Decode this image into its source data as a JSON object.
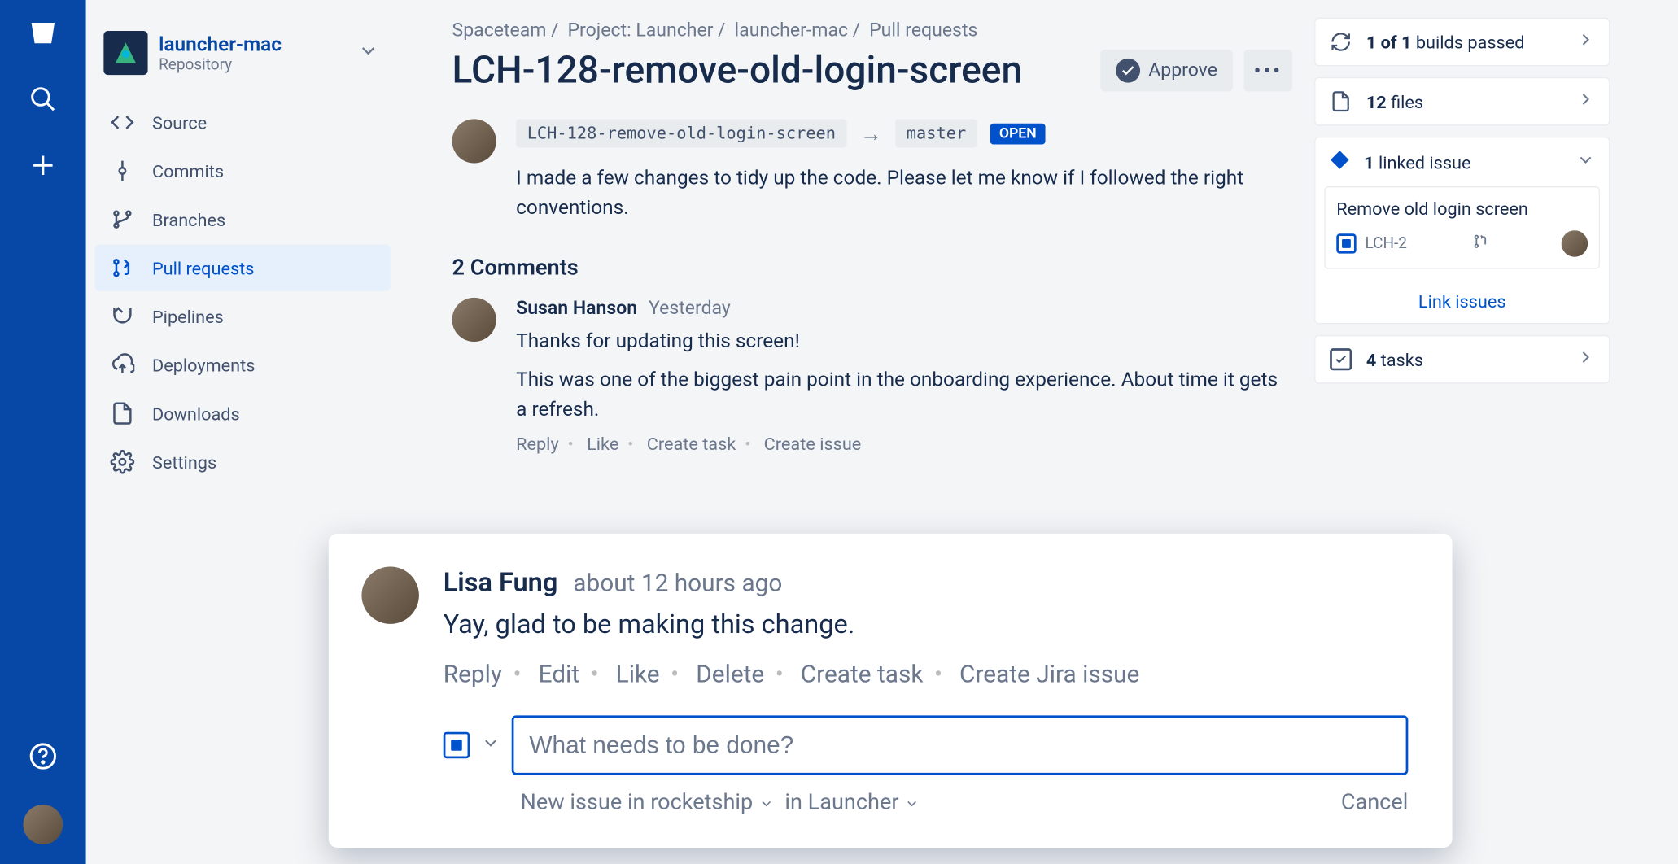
{
  "sidebar": {
    "repo_name": "launcher-mac",
    "repo_sub": "Repository",
    "items": [
      {
        "label": "Source"
      },
      {
        "label": "Commits"
      },
      {
        "label": "Branches"
      },
      {
        "label": "Pull requests"
      },
      {
        "label": "Pipelines"
      },
      {
        "label": "Deployments"
      },
      {
        "label": "Downloads"
      },
      {
        "label": "Settings"
      }
    ]
  },
  "breadcrumbs": [
    "Spaceteam",
    "Project: Launcher",
    "launcher-mac",
    "Pull requests"
  ],
  "pr": {
    "title": "LCH-128-remove-old-login-screen",
    "approve_label": "Approve",
    "source_branch": "LCH-128-remove-old-login-screen",
    "target_branch": "master",
    "status": "OPEN",
    "description": "I made a few changes to tidy up the code. Please let me know if I followed the right conventions."
  },
  "comments": {
    "heading": "2 Comments",
    "list": [
      {
        "author": "Susan Hanson",
        "time": "Yesterday",
        "body1": "Thanks for updating this screen!",
        "body2": "This was one of the biggest pain point in the onboarding experience. About time it gets a refresh.",
        "actions": {
          "reply": "Reply",
          "like": "Like",
          "task": "Create task",
          "issue": "Create issue"
        }
      }
    ]
  },
  "popover": {
    "author": "Lisa Fung",
    "time": "about 12 hours ago",
    "body": "Yay, glad to be making this change.",
    "actions": {
      "reply": "Reply",
      "edit": "Edit",
      "like": "Like",
      "delete": "Delete",
      "task": "Create task",
      "jira": "Create Jira issue"
    },
    "input_placeholder": "What needs to be done?",
    "meta_left_1": "New issue in rocketship",
    "meta_left_2": "in Launcher",
    "cancel": "Cancel"
  },
  "right": {
    "builds": {
      "prefix": "1 of 1",
      "suffix": " builds passed"
    },
    "files": {
      "count": "12",
      "label": " files"
    },
    "linked": {
      "count": "1",
      "label": " linked issue",
      "item_title": "Remove old login screen",
      "item_key": "LCH-2",
      "link_label": "Link issues"
    },
    "tasks": {
      "count": "4",
      "label": " tasks"
    }
  }
}
